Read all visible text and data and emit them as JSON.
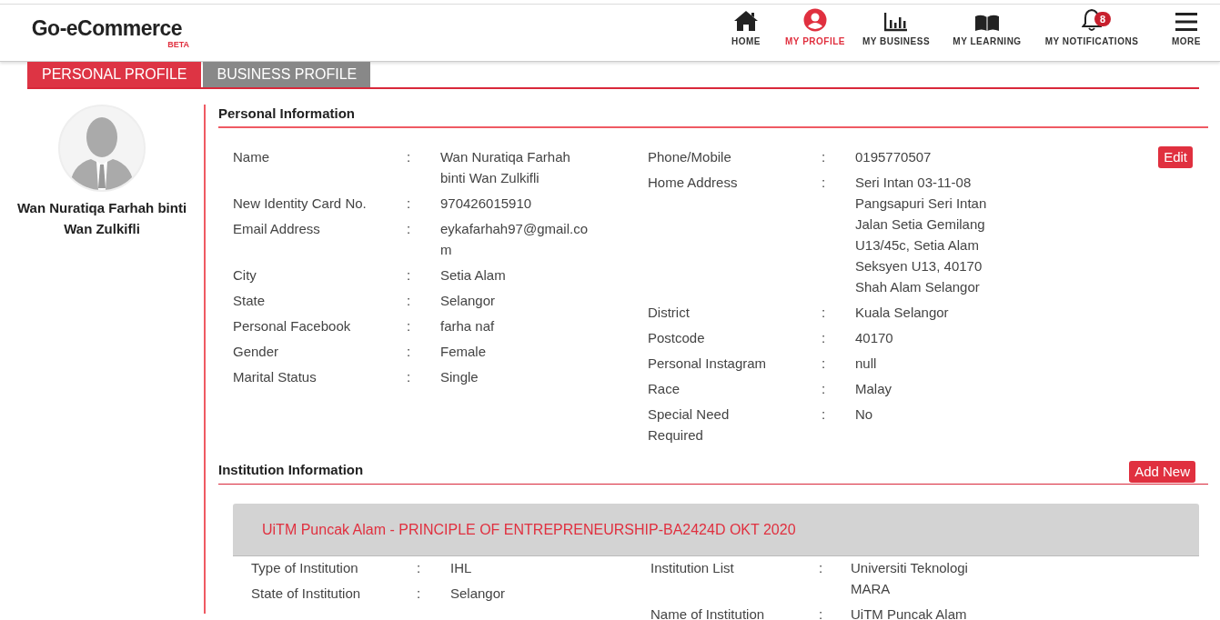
{
  "header": {
    "logo": "Go-eCommerce",
    "logo_badge": "BETA",
    "nav": [
      {
        "label": "HOME",
        "selected": false
      },
      {
        "label": "MY PROFILE",
        "selected": true
      },
      {
        "label": "MY BUSINESS",
        "selected": false
      },
      {
        "label": "MY LEARNING",
        "selected": false
      },
      {
        "label": "MY NOTIFICATIONS",
        "selected": false,
        "badge": "8"
      },
      {
        "label": "MORE",
        "selected": false
      }
    ]
  },
  "tabs": [
    {
      "label": "PERSONAL PROFILE",
      "selected": true
    },
    {
      "label": "BUSINESS PROFILE",
      "selected": false
    }
  ],
  "profile": {
    "name": "Wan Nuratiqa Farhah binti Wan Zulkifli"
  },
  "personal": {
    "title": "Personal Information",
    "edit_button": "Edit",
    "fields_left": [
      {
        "label": "Name",
        "separator": ":",
        "value": "Wan Nuratiqa Farhah binti Wan Zulkifli"
      },
      {
        "label": "New Identity Card No.",
        "separator": ":",
        "value": "970426015910"
      },
      {
        "label": "Email Address",
        "separator": ":",
        "value": "eykafarhah97@gmail.com"
      },
      {
        "label": "City",
        "separator": ":",
        "value": "Setia Alam"
      },
      {
        "label": "State",
        "separator": ":",
        "value": "Selangor"
      },
      {
        "label": "Personal Facebook",
        "separator": ":",
        "value": "farha naf"
      },
      {
        "label": "Gender",
        "separator": ":",
        "value": "Female"
      },
      {
        "label": "Marital Status",
        "separator": ":",
        "value": "Single"
      }
    ],
    "fields_right": [
      {
        "label": "Phone/Mobile",
        "separator": ":",
        "value": "0195770507"
      },
      {
        "label": "Home Address",
        "separator": ":",
        "value": "Seri Intan 03-11-08 Pangsapuri Seri Intan Jalan Setia Gemilang U13/45c, Setia Alam Seksyen U13, 40170 Shah Alam Selangor"
      },
      {
        "label": "District",
        "separator": ":",
        "value": "Kuala Selangor"
      },
      {
        "label": "Postcode",
        "separator": ":",
        "value": "40170"
      },
      {
        "label": "Personal Instagram",
        "separator": ":",
        "value": "null"
      },
      {
        "label": "Race",
        "separator": ":",
        "value": "Malay"
      },
      {
        "label": "Special Need Required",
        "separator": ":",
        "value": "No"
      }
    ]
  },
  "institution": {
    "title": "Institution Information",
    "add_button": "Add New",
    "cards": [
      {
        "title": "UiTM Puncak Alam - PRINCIPLE OF ENTREPRENEURSHIP-BA2424D OKT 2020",
        "fields_left": [
          {
            "label": "Type of Institution",
            "separator": ":",
            "value": "IHL"
          },
          {
            "label": "State of Institution",
            "separator": ":",
            "value": "Selangor"
          }
        ],
        "fields_right": [
          {
            "label": "Institution List",
            "separator": ":",
            "value": "Universiti Teknologi MARA"
          },
          {
            "label": "Name of Institution",
            "separator": ":",
            "value": "UiTM Puncak Alam"
          }
        ]
      }
    ]
  }
}
